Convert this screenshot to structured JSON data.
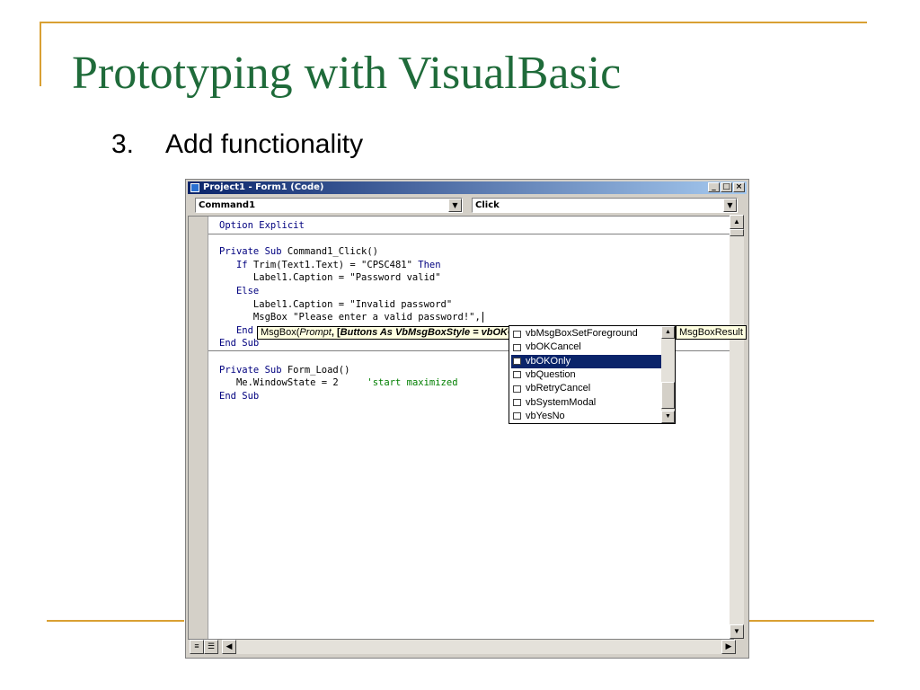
{
  "slide": {
    "title": "Prototyping with VisualBasic",
    "bullet_number": "3.",
    "bullet_text": "Add functionality"
  },
  "window": {
    "title": "Project1 - Form1 (Code)",
    "minimize_label": "_",
    "maximize_label": "□",
    "close_label": "×"
  },
  "object_combo": {
    "value": "Command1"
  },
  "procedure_combo": {
    "value": "Click"
  },
  "code_lines": [
    {
      "parts": [
        {
          "t": "Option Explicit",
          "c": "kw"
        }
      ]
    },
    {
      "parts": []
    },
    {
      "parts": [
        {
          "t": "Private Sub ",
          "c": "kw"
        },
        {
          "t": "Command1_Click()",
          "c": ""
        }
      ]
    },
    {
      "parts": [
        {
          "t": "   If ",
          "c": "kw"
        },
        {
          "t": "Trim(Text1.Text) = \"CPSC481\" ",
          "c": ""
        },
        {
          "t": "Then",
          "c": "kw"
        }
      ]
    },
    {
      "parts": [
        {
          "t": "      Label1.Caption = \"Password valid\"",
          "c": ""
        }
      ]
    },
    {
      "parts": [
        {
          "t": "   Else",
          "c": "kw"
        }
      ]
    },
    {
      "parts": [
        {
          "t": "      Label1.Caption = \"Invalid password\"",
          "c": ""
        }
      ]
    },
    {
      "parts": [
        {
          "t": "      MsgBox \"Please enter a valid password!\",",
          "c": ""
        }
      ]
    },
    {
      "parts": [
        {
          "t": "   End",
          "c": "kw"
        }
      ]
    },
    {
      "parts": [
        {
          "t": "End Sub",
          "c": "kw"
        }
      ]
    },
    {
      "parts": []
    },
    {
      "parts": [
        {
          "t": "Private Sub ",
          "c": "kw"
        },
        {
          "t": "Form_Load()",
          "c": ""
        }
      ]
    },
    {
      "parts": [
        {
          "t": "   Me.WindowState = 2     ",
          "c": ""
        },
        {
          "t": "'start maximized",
          "c": "cm"
        }
      ]
    },
    {
      "parts": [
        {
          "t": "End Sub",
          "c": "kw"
        }
      ]
    }
  ],
  "tooltip": {
    "prefix": "MsgBox(",
    "param1": "Prompt",
    "sep": ", [",
    "param2": "Buttons As VbMsgBoxStyle = vbOKO",
    "result": "MsgBoxResult"
  },
  "intellisense": {
    "items": [
      {
        "label": "vbMsgBoxSetForeground",
        "selected": false
      },
      {
        "label": "vbOKCancel",
        "selected": false
      },
      {
        "label": "vbOKOnly",
        "selected": true
      },
      {
        "label": "vbQuestion",
        "selected": false
      },
      {
        "label": "vbRetryCancel",
        "selected": false
      },
      {
        "label": "vbSystemModal",
        "selected": false
      },
      {
        "label": "vbYesNo",
        "selected": false
      }
    ]
  },
  "colors": {
    "title_green": "#1f6b3a",
    "accent_gold": "#d9a033",
    "keyword_blue": "#00007f",
    "comment_green": "#007f00",
    "selection_navy": "#0a246a"
  }
}
